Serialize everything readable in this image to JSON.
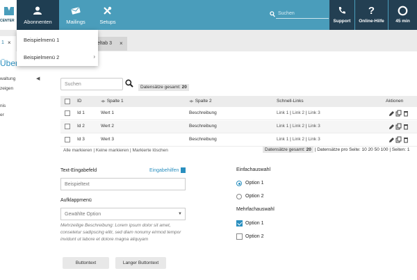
{
  "topbar": {
    "logo_text": "CENTER",
    "nav": [
      {
        "label": "Abonnenten",
        "icon": "user-icon"
      },
      {
        "label": "Mailings",
        "icon": "mail-icon"
      },
      {
        "label": "Setups",
        "icon": "tools-icon"
      }
    ],
    "search_placeholder": "Suchen",
    "right": [
      {
        "label": "Support",
        "icon": "phone-icon"
      },
      {
        "label": "Online-Hilfe",
        "icon": "question-icon"
      },
      {
        "label": "45 min",
        "icon": "timer-icon"
      }
    ],
    "colors": {
      "bar": "#4a9dbb",
      "dark": "#233f52",
      "active": "#1f3e52"
    }
  },
  "dropdown": {
    "items": [
      "Beispielmenü 1",
      "Beispielmenü 2"
    ],
    "submenu_arrow": "›"
  },
  "tabs": {
    "first_num": "1",
    "close": "×",
    "third": "eltab 3"
  },
  "sidebar": {
    "title": "Übers",
    "collapse": "◀",
    "items": [
      "waltung",
      "zeigen",
      "nis",
      "er"
    ]
  },
  "search": {
    "placeholder": "Suchen",
    "count_label": "Datensätze gesamt:",
    "count": "20"
  },
  "table": {
    "headers": {
      "id": "ID",
      "col1": "Spalte 1",
      "col2": "Spalte 2",
      "links": "Schnell-Links",
      "actions": "Aktionen"
    },
    "rows": [
      {
        "id": "Id 1",
        "col1": "Wert 1",
        "col2": "Beschreibung",
        "l1": "Link 1",
        "l2": "Link 2",
        "l3": "Link 3"
      },
      {
        "id": "Id 2",
        "col1": "Wert 2",
        "col2": "Beschreibung",
        "l1": "Link 1",
        "l2": "Link 2",
        "l3": "Link 3"
      },
      {
        "id": "Id 3",
        "col1": "Wert 3",
        "col2": "Beschreibung",
        "l1": "Link 1",
        "l2": "Link 2",
        "l3": "Link 3"
      }
    ],
    "link_sep": "|",
    "footer": {
      "select_all": "Alle markieren",
      "select_none": "Keine markieren",
      "clear": "Markierte löschen",
      "sep": "|",
      "count_label": "Datensätze gesamt:",
      "count": "20",
      "per_page_label": "Datensätze pro Seite:",
      "per_page": [
        "10",
        "20",
        "50",
        "100"
      ],
      "pages_label": "Seiten:",
      "pages": "1"
    }
  },
  "form": {
    "text_label": "Text-Eingabefeld",
    "help": "Eingabehilfen",
    "text_value": "Beispieltext",
    "select_label": "Aufklappmenü",
    "select_value": "Gewählte Option",
    "description": "Mehrzeilige Beschreibung: Lorem ipsum dolor sit amet, consetetur sadipscing elitr, sed diam nonumy eirmod tempor invidunt ut labore et dolore magna aliquyam",
    "button1": "Buttontext",
    "button2": "Langer Buttontext",
    "single_label": "Einfachauswahl",
    "radio": [
      {
        "label": "Option 1",
        "checked": true
      },
      {
        "label": "Option 2",
        "checked": false
      }
    ],
    "multi_label": "Mehrfachauswahl",
    "checks": [
      {
        "label": "Option 1",
        "checked": true
      },
      {
        "label": "Option 2",
        "checked": false
      }
    ]
  }
}
